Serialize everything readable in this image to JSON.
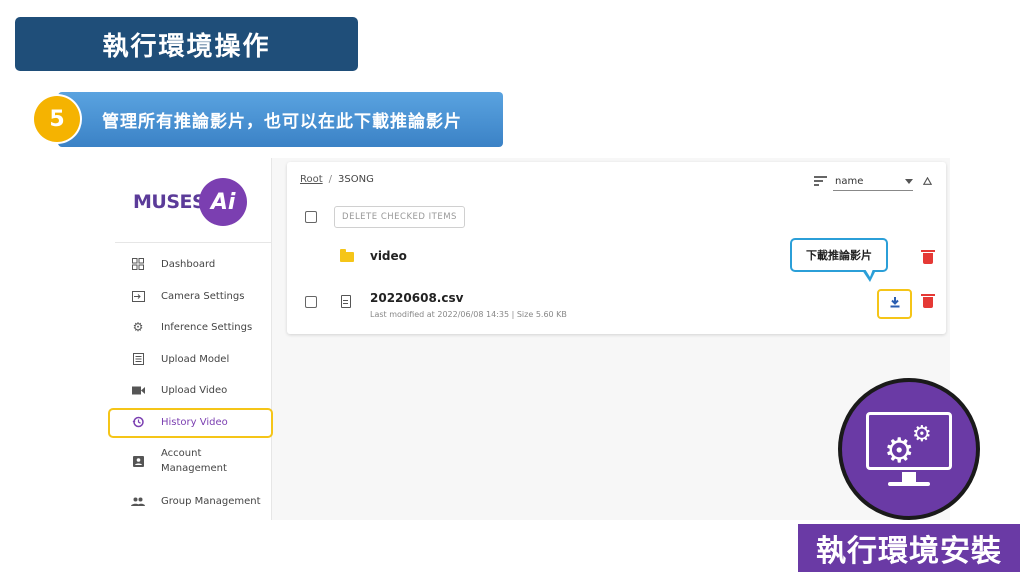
{
  "slide": {
    "title": "執行環境操作",
    "step_number": "5",
    "step_text": "管理所有推論影片，也可以在此下載推論影片"
  },
  "logo": {
    "text": "MUSES",
    "badge": "Ai"
  },
  "sidebar": {
    "items": [
      {
        "label": "Dashboard",
        "icon": "dashboard-icon"
      },
      {
        "label": "Camera Settings",
        "icon": "input-icon"
      },
      {
        "label": "Inference Settings",
        "icon": "gear-icon"
      },
      {
        "label": "Upload Model",
        "icon": "list-icon"
      },
      {
        "label": "Upload Video",
        "icon": "video-camera-icon"
      },
      {
        "label": "History Video",
        "icon": "history-icon",
        "active": true
      },
      {
        "label": "Account Management",
        "label_line1": "Account",
        "label_line2": "Management",
        "icon": "account-box-icon"
      },
      {
        "label": "Group Management",
        "icon": "group-icon"
      }
    ]
  },
  "file_browser": {
    "breadcrumb": {
      "root": "Root",
      "separator": "/",
      "current": "3SONG"
    },
    "sort": {
      "selected": "name",
      "direction_icon": "triangle-up-icon"
    },
    "delete_checked_label": "DELETE CHECKED ITEMS",
    "folder": {
      "name": "video"
    },
    "file": {
      "name": "20220608.csv",
      "meta": "Last modified at 2022/06/08 14:35 | Size 5.60 KB"
    }
  },
  "callout": {
    "text": "下載推論影片"
  },
  "emblem": {
    "label": "執行環境安裝"
  },
  "colors": {
    "title_bg": "#1f4e79",
    "banner": "#3b82c6",
    "step_badge": "#f5b301",
    "accent_purple": "#7b3fb1",
    "highlight": "#f5c518",
    "delete_red": "#e53935",
    "callout_border": "#2b9fd8"
  }
}
